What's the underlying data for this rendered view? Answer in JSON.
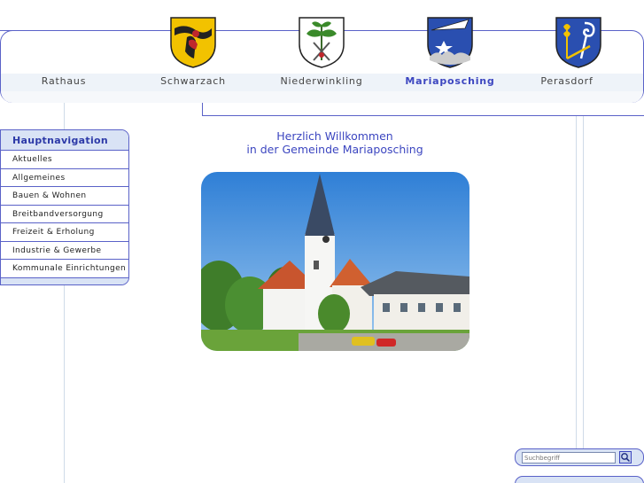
{
  "nav": {
    "tabs": [
      {
        "label": "Rathaus",
        "active": false
      },
      {
        "label": "Schwarzach",
        "active": false
      },
      {
        "label": "Niederwinkling",
        "active": false
      },
      {
        "label": "Mariaposching",
        "active": true
      },
      {
        "label": "Perasdorf",
        "active": false
      }
    ]
  },
  "sidebar": {
    "title": "Hauptnavigation",
    "items": [
      {
        "label": "Aktuelles"
      },
      {
        "label": "Allgemeines"
      },
      {
        "label": "Bauen & Wohnen"
      },
      {
        "label": "Breitbandversorgung"
      },
      {
        "label": "Freizeit & Erholung"
      },
      {
        "label": "Industrie & Gewerbe"
      },
      {
        "label": "Kommunale Einrichtungen"
      }
    ]
  },
  "main": {
    "welcome_line1": "Herzlich Willkommen",
    "welcome_line2": "in der Gemeinde Mariaposching"
  },
  "search": {
    "placeholder": "Suchbegriff"
  },
  "colors": {
    "accent": "#3c46c0",
    "border": "#5a62c8",
    "panel": "#d9e3f5"
  }
}
